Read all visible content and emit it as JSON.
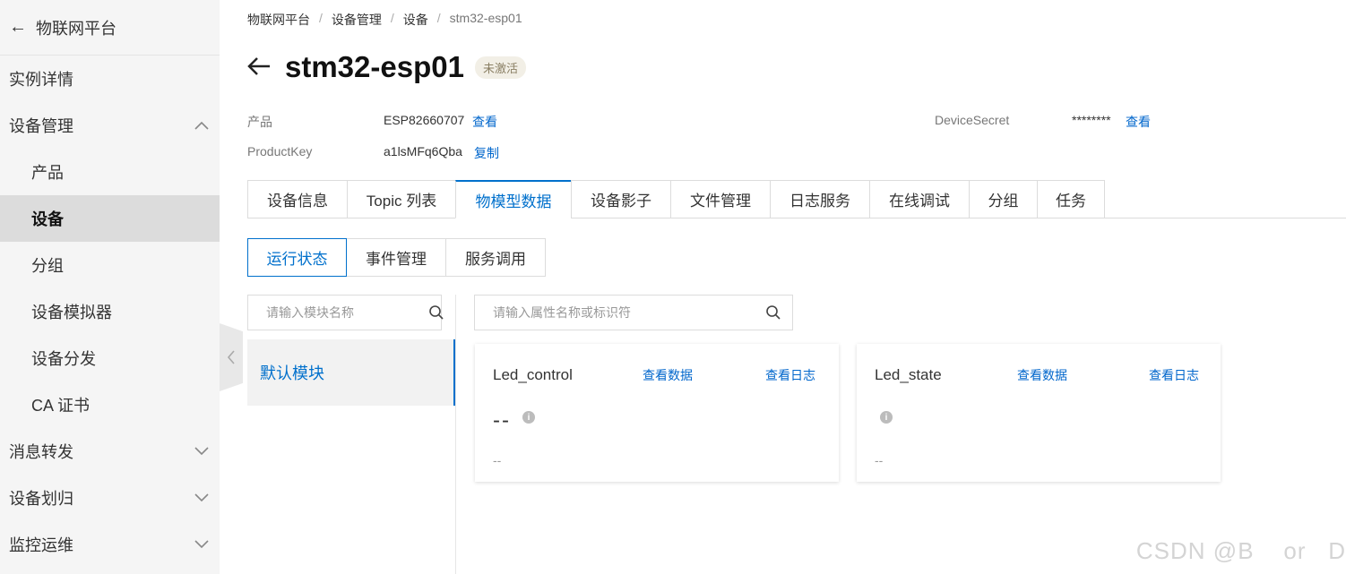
{
  "sidebar": {
    "back_label": "物联网平台",
    "items": [
      {
        "label": "实例详情",
        "chevron": ""
      },
      {
        "label": "设备管理",
        "chevron": "up"
      },
      {
        "label": "产品",
        "chevron": ""
      },
      {
        "label": "设备",
        "chevron": ""
      },
      {
        "label": "分组",
        "chevron": ""
      },
      {
        "label": "设备模拟器",
        "chevron": ""
      },
      {
        "label": "设备分发",
        "chevron": ""
      },
      {
        "label": "CA 证书",
        "chevron": ""
      },
      {
        "label": "消息转发",
        "chevron": "down"
      },
      {
        "label": "设备划归",
        "chevron": "down"
      },
      {
        "label": "监控运维",
        "chevron": "down"
      }
    ]
  },
  "breadcrumb": [
    "物联网平台",
    "设备管理",
    "设备",
    "stm32-esp01"
  ],
  "device": {
    "name": "stm32-esp01",
    "status": "未激活",
    "product_label": "产品",
    "product_value": "ESP82660707",
    "product_link": "查看",
    "productkey_label": "ProductKey",
    "productkey_value": "a1lsMFq6Qba",
    "productkey_link": "复制",
    "secret_label": "DeviceSecret",
    "secret_value": "********",
    "secret_link": "查看"
  },
  "tabs": [
    "设备信息",
    "Topic 列表",
    "物模型数据",
    "设备影子",
    "文件管理",
    "日志服务",
    "在线调试",
    "分组",
    "任务"
  ],
  "active_tab": 2,
  "subtabs": [
    "运行状态",
    "事件管理",
    "服务调用"
  ],
  "active_subtab": 0,
  "module_search_placeholder": "请输入模块名称",
  "property_search_placeholder": "请输入属性名称或标识符",
  "module_default": "默认模块",
  "cards": [
    {
      "name": "Led_control",
      "view_data": "查看数据",
      "view_log": "查看日志",
      "value": "--",
      "time": "--"
    },
    {
      "name": "Led_state",
      "view_data": "查看数据",
      "view_log": "查看日志",
      "value": "",
      "time": "--"
    }
  ],
  "watermark": "CSDN @B    or   D",
  "colors": {
    "accent": "#0070cc",
    "sidebar_bg": "#f5f5f5",
    "badge_bg": "#f2efe6"
  }
}
